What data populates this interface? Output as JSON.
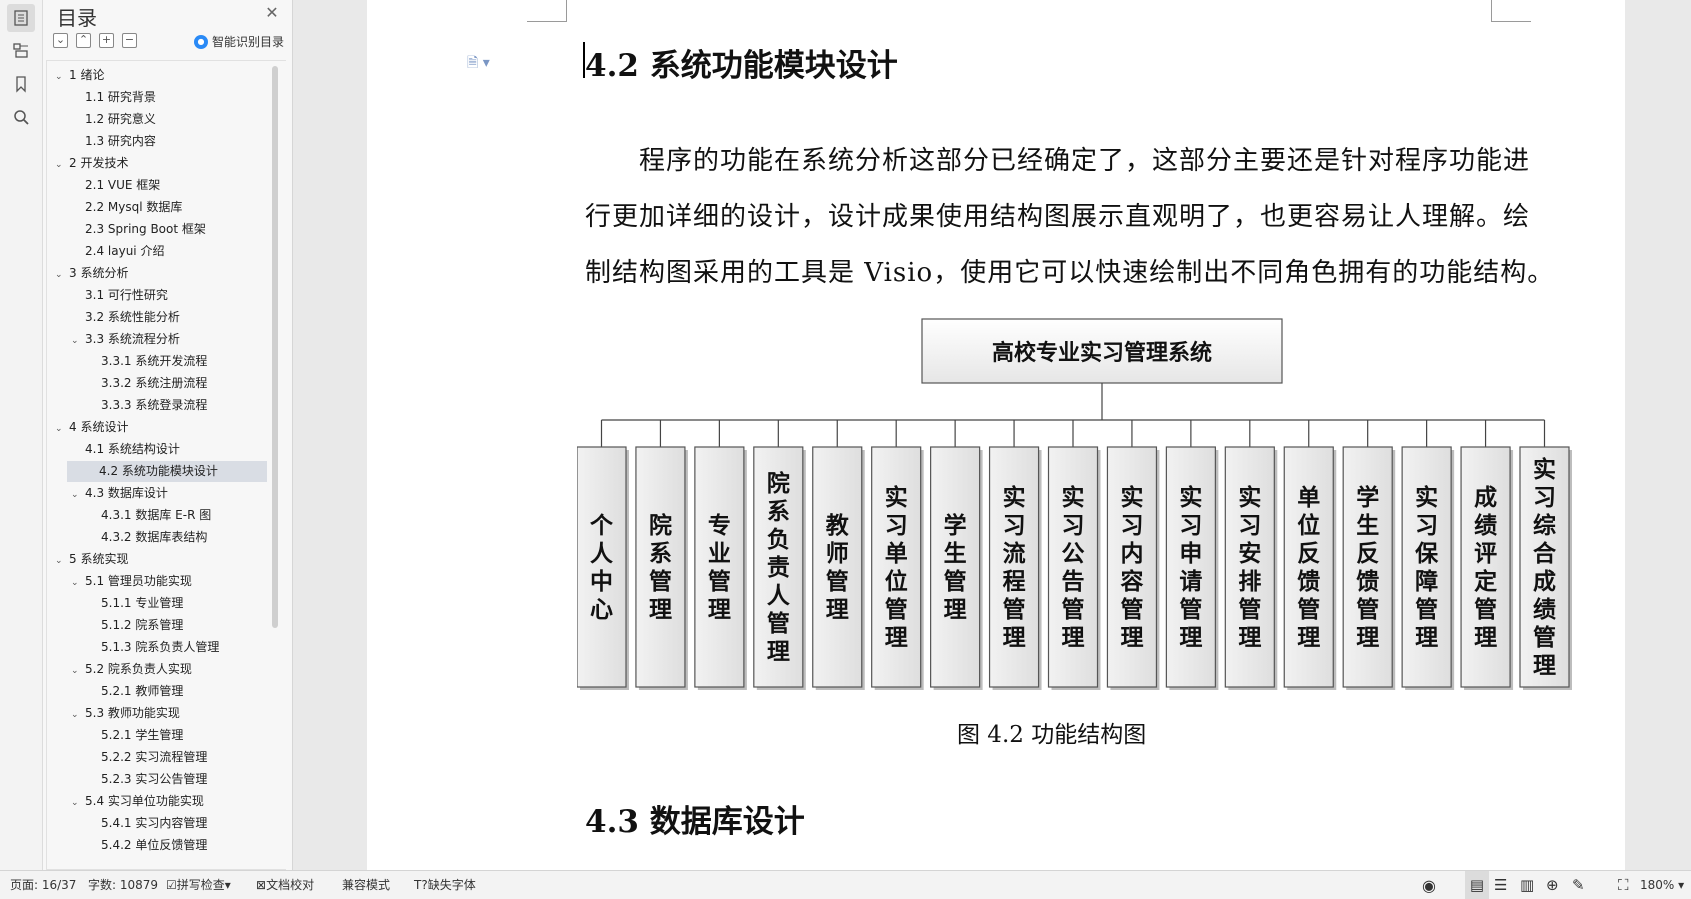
{
  "toc": {
    "title": "目录",
    "smart_label": "智能识别目录",
    "items": [
      {
        "label": "1  绪论",
        "level": 1,
        "expanded": true
      },
      {
        "label": "1.1  研究背景",
        "level": 2
      },
      {
        "label": "1.2  研究意义",
        "level": 2
      },
      {
        "label": "1.3  研究内容",
        "level": 2
      },
      {
        "label": "2  开发技术",
        "level": 1,
        "expanded": true
      },
      {
        "label": "2.1 VUE 框架",
        "level": 2
      },
      {
        "label": "2.2 Mysql 数据库",
        "level": 2
      },
      {
        "label": "2.3 Spring Boot 框架",
        "level": 2
      },
      {
        "label": "2.4 layui 介绍",
        "level": 2
      },
      {
        "label": "3  系统分析",
        "level": 1,
        "expanded": true
      },
      {
        "label": "3.1 可行性研究",
        "level": 2
      },
      {
        "label": "3.2 系统性能分析",
        "level": 2
      },
      {
        "label": "3.3  系统流程分析",
        "level": 2,
        "expanded": true
      },
      {
        "label": "3.3.1  系统开发流程",
        "level": 3
      },
      {
        "label": "3.3.2  系统注册流程",
        "level": 3
      },
      {
        "label": "3.3.3  系统登录流程",
        "level": 3
      },
      {
        "label": "4  系统设计",
        "level": 1,
        "expanded": true
      },
      {
        "label": "4.1  系统结构设计",
        "level": 2
      },
      {
        "label": "4.2 系统功能模块设计",
        "level": 2,
        "selected": true
      },
      {
        "label": "4.3 数据库设计",
        "level": 2,
        "expanded": true
      },
      {
        "label": "4.3.1 数据库 E-R 图",
        "level": 3
      },
      {
        "label": "4.3.2  数据库表结构",
        "level": 3
      },
      {
        "label": "5  系统实现",
        "level": 1,
        "expanded": true
      },
      {
        "label": "5.1  管理员功能实现",
        "level": 2,
        "expanded": true
      },
      {
        "label": "5.1.1  专业管理",
        "level": 3
      },
      {
        "label": "5.1.2  院系管理",
        "level": 3
      },
      {
        "label": "5.1.3  院系负责人管理",
        "level": 3
      },
      {
        "label": "5.2  院系负责人实现",
        "level": 2,
        "expanded": true
      },
      {
        "label": "5.2.1  教师管理",
        "level": 3
      },
      {
        "label": "5.3  教师功能实现",
        "level": 2,
        "expanded": true
      },
      {
        "label": "5.2.1  学生管理",
        "level": 3
      },
      {
        "label": "5.2.2  实习流程管理",
        "level": 3
      },
      {
        "label": "5.2.3  实习公告管理",
        "level": 3
      },
      {
        "label": "5.4  实习单位功能实现",
        "level": 2,
        "expanded": true
      },
      {
        "label": "5.4.1  实习内容管理",
        "level": 3
      },
      {
        "label": "5.4.2  单位反馈管理",
        "level": 3
      }
    ]
  },
  "doc": {
    "heading_42": "4.2 系统功能模块设计",
    "para_lines": [
      "程序的功能在系统分析这部分已经确定了，这部分主要还是针对程序功能进",
      "行更加详细的设计，设计成果使用结构图展示直观明了，也更容易让人理解。绘",
      "制结构图采用的工具是 Visio，使用它可以快速绘制出不同角色拥有的功能结构。"
    ],
    "diagram": {
      "root": "高校专业实习管理系统",
      "children": [
        "个人中心",
        "院系管理",
        "专业管理",
        "院系负责人管理",
        "教师管理",
        "实习单位管理",
        "学生管理",
        "实习流程管理",
        "实习公告管理",
        "实习内容管理",
        "实习申请管理",
        "实习安排管理",
        "单位反馈管理",
        "学生反馈管理",
        "实习保障管理",
        "成绩评定管理",
        "实习综合成绩管理"
      ]
    },
    "caption": "图 4.2  功能结构图",
    "heading_43": "4.3 数据库设计"
  },
  "status": {
    "page": "页面: 16/37",
    "words": "字数: 10879",
    "spell": "拼写检查",
    "proof": "文档校对",
    "compat": "兼容模式",
    "missing_font": "缺失字体",
    "zoom": "180%"
  }
}
